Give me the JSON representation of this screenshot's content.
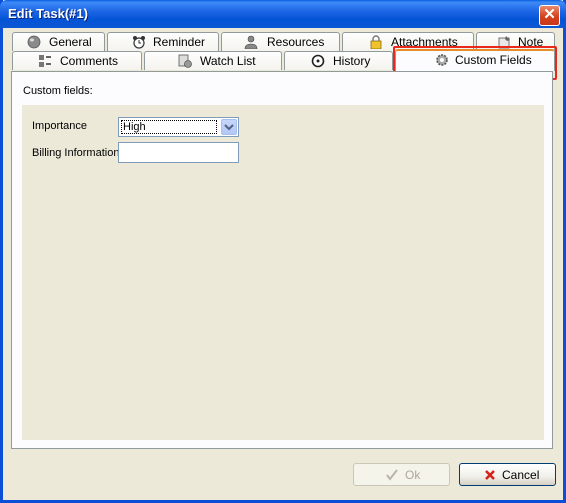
{
  "window": {
    "title": "Edit Task(#1)"
  },
  "tabs_row1": [
    {
      "label": "General",
      "icon": "globe-icon"
    },
    {
      "label": "Reminder",
      "icon": "alarm-clock-icon"
    },
    {
      "label": "Resources",
      "icon": "person-icon"
    },
    {
      "label": "Attachments",
      "icon": "padlock-icon"
    },
    {
      "label": "Note",
      "icon": "note-pin-icon"
    }
  ],
  "tabs_row2": [
    {
      "label": "Comments",
      "icon": "comments-icon"
    },
    {
      "label": "Watch List",
      "icon": "watch-list-icon"
    },
    {
      "label": "History",
      "icon": "history-icon"
    },
    {
      "label": "Custom Fields",
      "icon": "gear-icon",
      "selected": true
    }
  ],
  "page": {
    "heading": "Custom fields:",
    "fields": {
      "importance_label": "Importance",
      "importance_value": "High",
      "billing_label": "Billing Information",
      "billing_value": ""
    }
  },
  "buttons": {
    "ok_label": "Ok",
    "cancel_label": "Cancel"
  },
  "colors": {
    "titlebar": "#0454d6",
    "highlight": "#e8281c",
    "tab_active_accent": "#e68b2c"
  }
}
